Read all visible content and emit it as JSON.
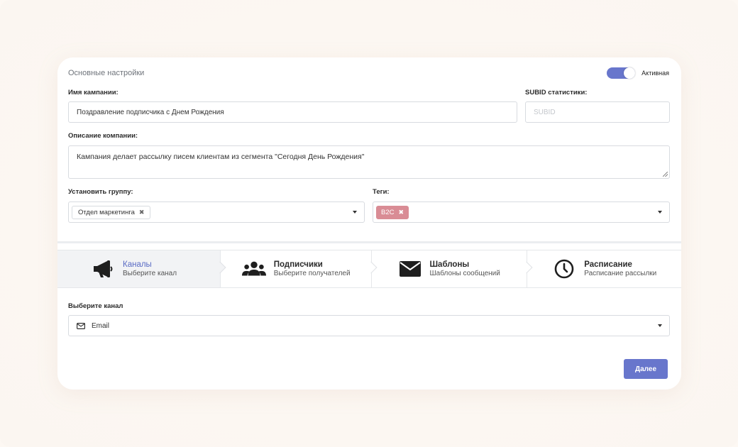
{
  "basic": {
    "section_title": "Основные настройки",
    "toggle_label": "Активная",
    "toggle_on": true
  },
  "campaign": {
    "name_label": "Имя кампании:",
    "name_value": "Поздравление подписчика с Днем Рождения",
    "subid_label": "SUBID статистики:",
    "subid_placeholder": "SUBID",
    "description_label": "Описание компании:",
    "description_value": "Кампания делает рассылку писем клиентам из сегмента \"Сегодня День Рождения\""
  },
  "group": {
    "label": "Установить группу:",
    "chip": "Отдел маркетинга",
    "chip_remove": "✖"
  },
  "tags": {
    "label": "Теги:",
    "chip": "B2C",
    "chip_remove": "✖",
    "chip_color": "#d98c95"
  },
  "steps": [
    {
      "title": "Каналы",
      "subtitle": "Выберите канал",
      "icon": "megaphone-icon",
      "active": true
    },
    {
      "title": "Подписчики",
      "subtitle": "Выберите получателей",
      "icon": "users-icon",
      "active": false
    },
    {
      "title": "Шаблоны",
      "subtitle": "Шаблоны сообщений",
      "icon": "envelope-icon",
      "active": false
    },
    {
      "title": "Расписание",
      "subtitle": "Расписание рассылки",
      "icon": "clock-icon",
      "active": false
    }
  ],
  "channel": {
    "label": "Выберите канал",
    "value": "Email",
    "icon": "envelope-outline-icon"
  },
  "next_button": "Далее",
  "colors": {
    "accent": "#6876cc",
    "active_step_text": "#5a6bc4",
    "tag": "#d98c95"
  }
}
